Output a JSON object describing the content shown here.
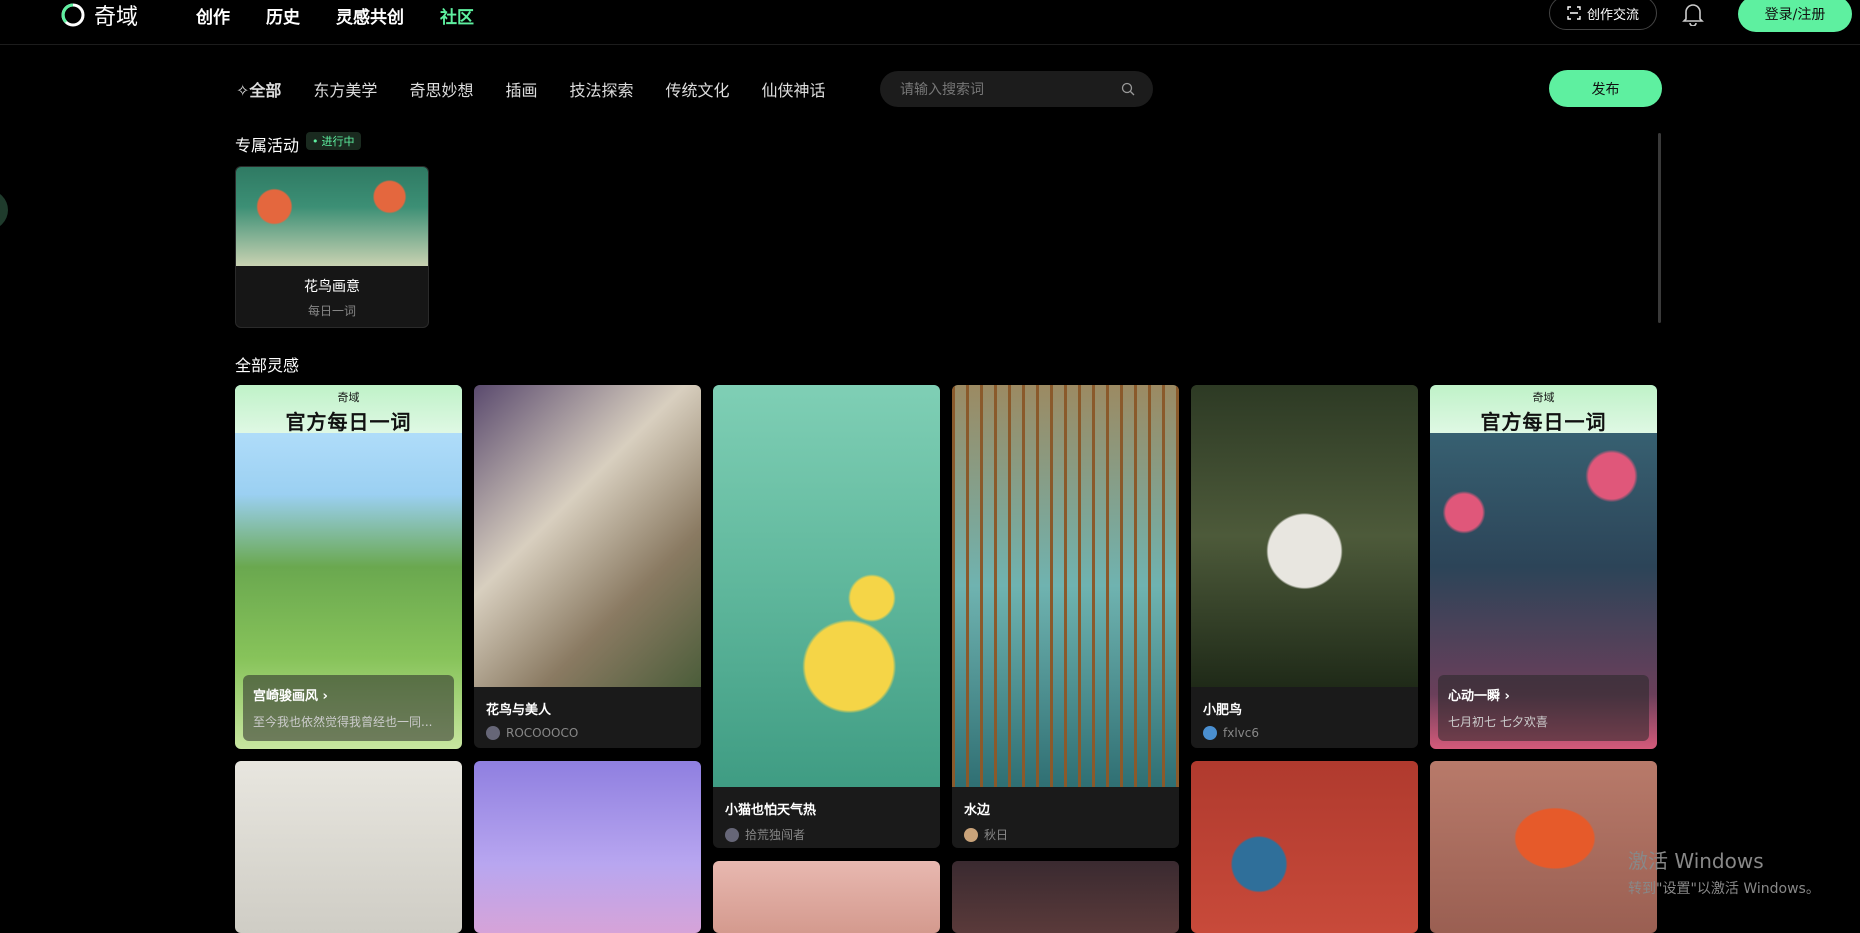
{
  "app": {
    "name": "奇域"
  },
  "nav": {
    "items": [
      "创作",
      "历史",
      "灵感共创",
      "社区"
    ],
    "active_index": 3
  },
  "header": {
    "chat_label": "创作交流",
    "login_label": "登录/注册"
  },
  "filters": {
    "items": [
      "全部",
      "东方美学",
      "奇思妙想",
      "插画",
      "技法探索",
      "传统文化",
      "仙侠神话"
    ],
    "active_index": 0
  },
  "search": {
    "placeholder": "请输入搜索词"
  },
  "publish_label": "发布",
  "activity": {
    "section_title": "专属活动",
    "badge": "进行中",
    "card": {
      "title": "花鸟画意",
      "subtitle": "每日一词"
    }
  },
  "feed": {
    "section_title": "全部灵感",
    "banner_small": "奇域",
    "banner_big": "官方每日一词",
    "cards": [
      {
        "title": "宫崎骏画风",
        "subtitle": "至今我也依然觉得我曾经也一同...",
        "type": "official"
      },
      {
        "title": "花鸟与美人",
        "author": "ROCOOOCO"
      },
      {
        "title": "小猫也怕天气热",
        "author": "拾荒独闯者"
      },
      {
        "title": "水边",
        "author": "秋日"
      },
      {
        "title": "小肥鸟",
        "author": "fxlvc6"
      },
      {
        "title": "心动一瞬",
        "subtitle": "七月初七 七夕欢喜",
        "type": "official"
      }
    ]
  },
  "watermark": {
    "line1": "激活 Windows",
    "line2": "转到\"设置\"以激活 Windows。"
  },
  "colors": {
    "accent": "#5ef0a0",
    "background": "#000000"
  }
}
